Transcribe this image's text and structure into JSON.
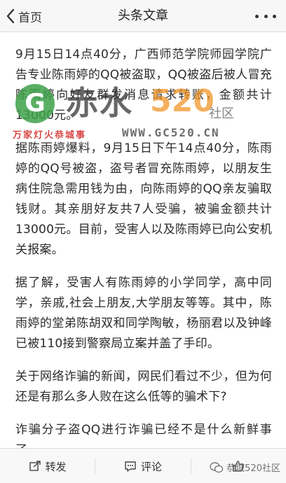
{
  "nav": {
    "back_label": "首页",
    "title": "头条文章"
  },
  "article": {
    "paragraphs": [
      "9月15日14点40分，广西师范学院师园学院广告专业陈雨婷的QQ被盗取，QQ被盗后被人冒充陈雨婷向好友群发消息请求转账，金额共计13000元。",
      "据陈雨婷爆料，9月15日下午14点40分，陈雨婷的QQ号被盗，盗号者冒充陈雨婷，以朋友生病住院急需用钱为由，向陈雨婷的QQ亲友骗取钱财。其亲朋好友共7人受骗，被骗金额共计13000元。目前，受害人以及陈雨婷已向公安机关报案。",
      "据了解，受害人有陈雨婷的小学同学，高中同学，亲戚,社会上朋友,大学朋友等等。其中，陈雨婷的堂弟陈胡双和同学陶敏，杨丽君以及钟峰已被110接到警察局立案并盖了手印。",
      "关于网络诈骗的新闻，网民们看过不少，但为何还是有那么多人败在这么低等的骗术下?",
      "诈骗分子盗QQ进行诈骗已经不是什么新鲜事了。"
    ]
  },
  "watermark": {
    "brand": "赤水",
    "number": "520",
    "district": "社区",
    "slogan": "万家灯火恭城事",
    "domain": "WWW.GC520.CN"
  },
  "toolbar": {
    "share_label": "转发",
    "comment_label": "评论",
    "like_label": ""
  },
  "footer_mark": {
    "text": "恭城520社区"
  },
  "colors": {
    "nav_bg": "#f7f7f7",
    "text": "#2b2b2b",
    "watermark_green": "#3ea14a",
    "watermark_orange": "#f09628",
    "watermark_red": "#d22828"
  }
}
